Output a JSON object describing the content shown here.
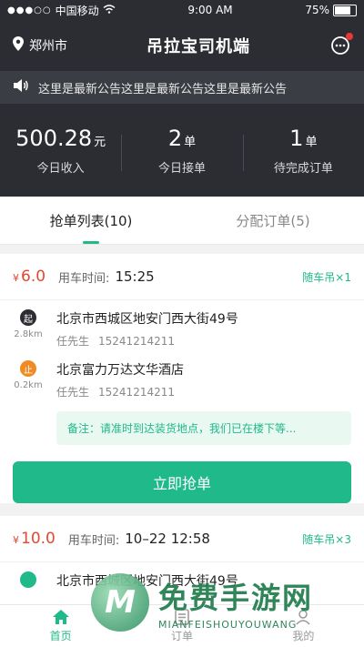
{
  "status_bar": {
    "carrier": "中国移动",
    "time": "9:00 AM",
    "battery": "75%"
  },
  "header": {
    "city": "郑州市",
    "title": "吊拉宝司机端"
  },
  "notice": {
    "text": "这里是最新公告这里是最新公告这里是最新公告"
  },
  "stats": [
    {
      "value": "500.28",
      "unit": "元",
      "label": "今日收入"
    },
    {
      "value": "2",
      "unit": "单",
      "label": "今日接单"
    },
    {
      "value": "1",
      "unit": "单",
      "label": "待完成订单"
    }
  ],
  "tabs": [
    {
      "label": "抢单列表(10)",
      "active": true
    },
    {
      "label": "分配订单(5)",
      "active": false
    }
  ],
  "orders": [
    {
      "currency": "¥",
      "price": "6.0",
      "time_label": "用车时间:",
      "time": "15:25",
      "tag": "随车吊×1",
      "start": {
        "icon": "起",
        "distance": "2.8km",
        "address": "北京市西城区地安门西大街49号",
        "name": "任先生",
        "phone": "15241214211"
      },
      "end": {
        "icon": "止",
        "distance": "0.2km",
        "address": "北京富力万达文华酒店",
        "name": "任先生",
        "phone": "15241214211"
      },
      "note": "备注：请准时到达装货地点，我们已在楼下等...",
      "button": "立即抢单"
    },
    {
      "currency": "¥",
      "price": "10.0",
      "time_label": "用车时间:",
      "time": "10–22 12:58",
      "tag": "随车吊×3",
      "start": {
        "address": "北京市西城区地安门西大街49号"
      }
    }
  ],
  "bottom_nav": [
    {
      "label": "首页",
      "active": true
    },
    {
      "label": "订单",
      "active": false
    },
    {
      "label": "我的",
      "active": false
    }
  ],
  "watermark": {
    "cn": "免费手游网",
    "en": "MIANFEISHOUYOUWANG"
  },
  "colors": {
    "accent": "#1fb98a",
    "price": "#e5472f",
    "header_bg": "#2b2d33"
  }
}
